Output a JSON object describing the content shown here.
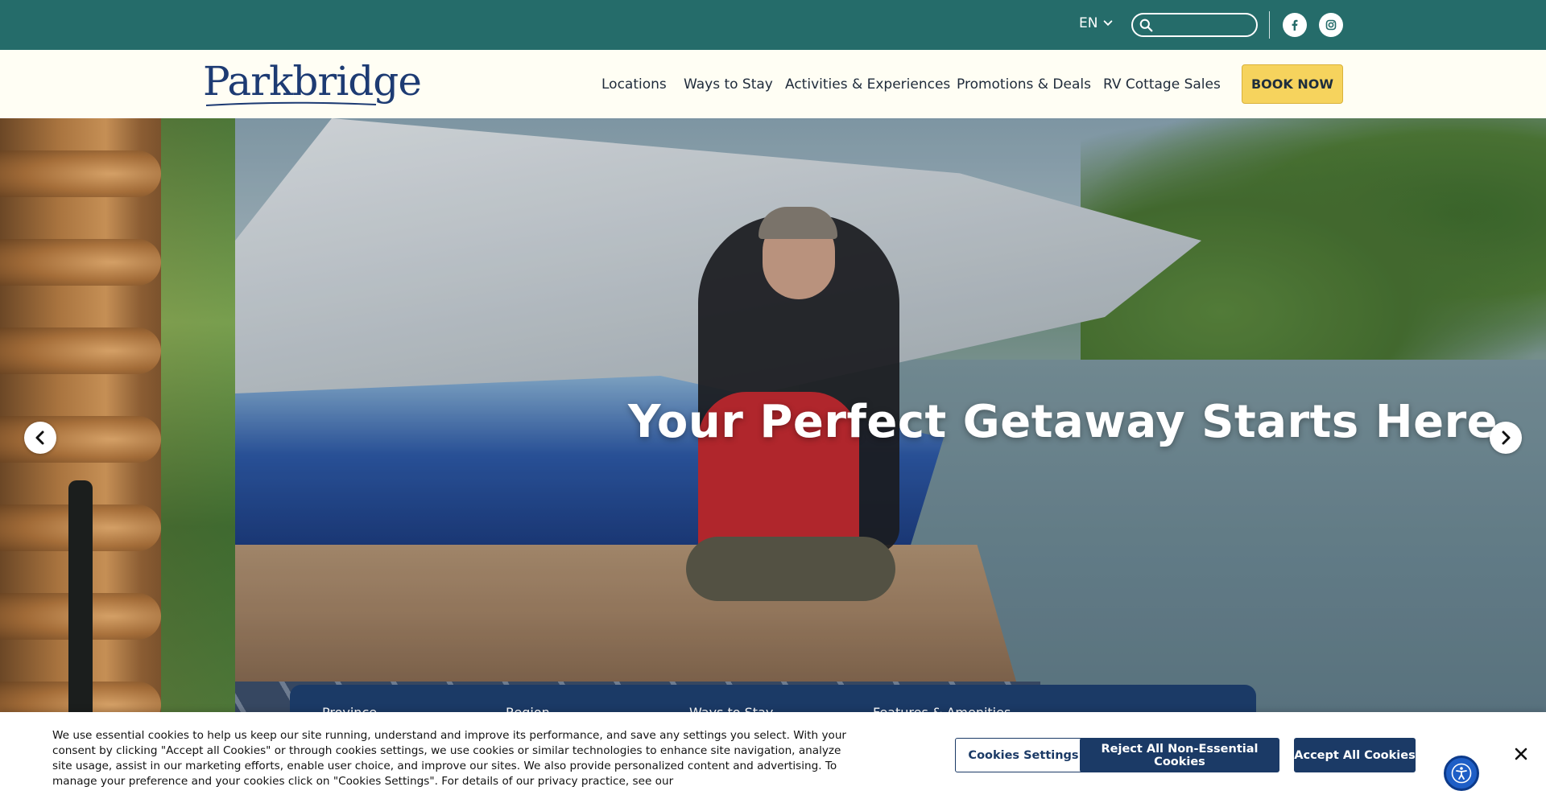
{
  "topbar": {
    "language": "EN",
    "search": {
      "placeholder": "",
      "value": ""
    },
    "social": [
      "facebook-icon",
      "instagram-icon"
    ]
  },
  "header": {
    "logo": "Parkbridge",
    "nav": [
      "Locations",
      "Ways to Stay",
      "Activities & Experiences",
      "Promotions & Deals",
      "RV Cottage Sales"
    ],
    "book_now": "BOOK NOW"
  },
  "hero": {
    "headline": "Your Perfect Getaway Starts Here"
  },
  "finder": {
    "fields": [
      "Province",
      "Region",
      "Ways to Stay",
      "Features & Amenities"
    ]
  },
  "cookie": {
    "text": "We use essential cookies to help us keep our site running, understand and improve its performance, and save any settings you select. With your consent by clicking \"Accept all Cookies\" or through cookies settings, we use cookies or similar technologies to enhance site navigation, analyze site usage, assist in our marketing efforts, enable user choice, and improve our sites. We also provide personalized content and advertising. To manage your preference and your cookies click on \"Cookies Settings\". For details of our privacy practice, see our",
    "settings_label": "Cookies Settings",
    "reject_label": "Reject All Non-Essential Cookies",
    "accept_label": "Accept All Cookies"
  },
  "colors": {
    "topbar": "#256c6a",
    "header_bg": "#fffef4",
    "logo": "#1d3b73",
    "book_button": "#f6d35d",
    "navy": "#1b3a66",
    "accessibility": "#1e5ec6"
  }
}
